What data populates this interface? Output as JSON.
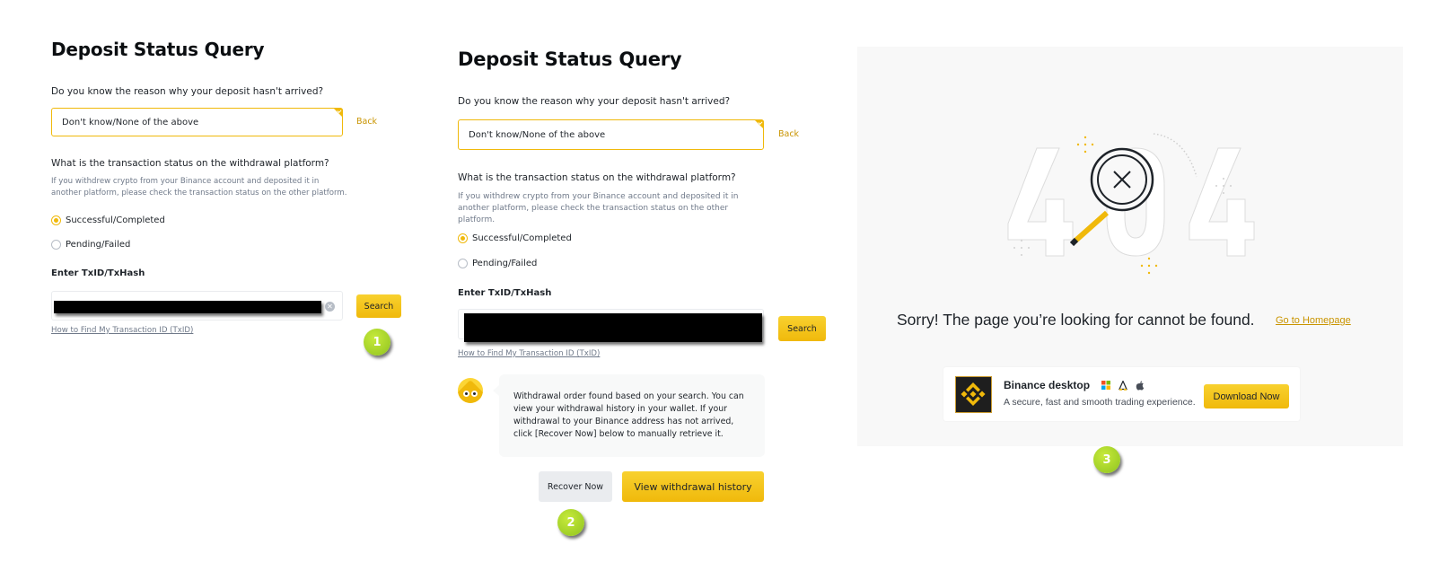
{
  "panel1": {
    "title": "Deposit Status Query",
    "reason_question": "Do you know the reason why your deposit hasn't arrived?",
    "reason_selected": "Don't know/None of the above",
    "back_label": "Back",
    "status_question": "What is the transaction status on the withdrawal platform?",
    "status_help": "If you withdrew crypto from your Binance account and deposited it in another platform, please check the transaction status on the other platform.",
    "status_options": [
      "Successful/Completed",
      "Pending/Failed"
    ],
    "status_selected": "Successful/Completed",
    "txid_label": "Enter TxID/TxHash",
    "txid_value": "[redacted]",
    "search_label": "Search",
    "txid_help_link": "How to Find My Transaction ID (TxID)",
    "step_badge": "1"
  },
  "panel2": {
    "title": "Deposit Status Query",
    "reason_question": "Do you know the reason why your deposit hasn't arrived?",
    "reason_selected": "Don't know/None of the above",
    "back_label": "Back",
    "status_question": "What is the transaction status on the withdrawal platform?",
    "status_help": "If you withdrew crypto from your Binance account and deposited it in another platform, please check the transaction status on the other platform.",
    "status_options": [
      "Successful/Completed",
      "Pending/Failed"
    ],
    "status_selected": "Successful/Completed",
    "txid_label": "Enter TxID/TxHash",
    "txid_value": "[redacted]",
    "search_label": "Search",
    "txid_help_link": "How to Find My Transaction ID (TxID)",
    "result_message": "Withdrawal order found based on your search. You can view your withdrawal history in your wallet. If your withdrawal to your Binance address has not arrived, click [Recover Now] below to manually retrieve it.",
    "recover_label": "Recover Now",
    "view_history_label": "View withdrawal history",
    "step_badge": "2"
  },
  "panel3": {
    "error_code": "404",
    "error_message": "Sorry! The page you’re looking for cannot be found.",
    "home_link": "Go to Homepage",
    "app_card": {
      "name": "Binance desktop",
      "tagline": "A secure, fast and smooth trading experience.",
      "platform_icons": [
        "windows-icon",
        "linux-icon",
        "apple-icon"
      ],
      "download_label": "Download Now"
    },
    "step_badge": "3"
  },
  "colors": {
    "accent": "#f0b90b",
    "link": "#c99400",
    "badge": "#a6d22a",
    "panel_bg": "#f8f8f8"
  }
}
